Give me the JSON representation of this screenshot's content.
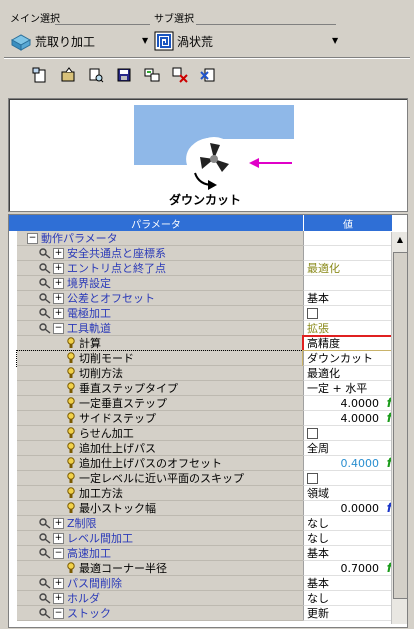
{
  "header": {
    "main_label": "メイン選択",
    "sub_label": "サブ選択",
    "main_value": "荒取り加工",
    "sub_value": "渦状荒"
  },
  "toolbar": {
    "icons": [
      "new-icon",
      "open-icon",
      "find-icon",
      "save-icon",
      "copy-icon",
      "settings-icon",
      "calculate-icon"
    ]
  },
  "preview": {
    "caption": "ダウンカット",
    "arrow_color": "#e000c8",
    "material_color": "#8fb8e8"
  },
  "grid": {
    "col_param": "パラメータ",
    "col_value": "値",
    "rows": [
      {
        "name": "動作パラメータ",
        "value": "",
        "color": "blue",
        "indent": 0,
        "expander": "minus",
        "icon": "none"
      },
      {
        "name": "安全共通点と座標系",
        "value": "",
        "color": "blue",
        "indent": 1,
        "expander": "plus",
        "icon": "key"
      },
      {
        "name": "エントリ点と終了点",
        "value": "最適化",
        "value_color": "olive",
        "color": "blue",
        "indent": 1,
        "expander": "plus",
        "icon": "key"
      },
      {
        "name": "境界設定",
        "value": "",
        "color": "blue",
        "indent": 1,
        "expander": "plus",
        "icon": "key"
      },
      {
        "name": "公差とオフセット",
        "value": "基本",
        "color": "blue",
        "indent": 1,
        "expander": "plus",
        "icon": "key"
      },
      {
        "name": "電極加工",
        "value": "",
        "checkbox": true,
        "color": "blue",
        "indent": 1,
        "expander": "plus",
        "icon": "key"
      },
      {
        "name": "工具軌道",
        "value": "拡張",
        "value_color": "olive",
        "color": "blue",
        "indent": 1,
        "expander": "minus",
        "icon": "key"
      },
      {
        "name": "計算",
        "value": "高精度",
        "color": "black",
        "indent": 2,
        "expander": "none",
        "icon": "bulb"
      },
      {
        "name": "切削モード",
        "value": "ダウンカット",
        "color": "black",
        "indent": 2,
        "expander": "none",
        "icon": "bulb",
        "selected": true
      },
      {
        "name": "切削方法",
        "value": "最適化",
        "color": "black",
        "indent": 2,
        "expander": "none",
        "icon": "bulb"
      },
      {
        "name": "垂直ステップタイプ",
        "value": "一定 + 水平",
        "color": "black",
        "indent": 2,
        "expander": "none",
        "icon": "bulb"
      },
      {
        "name": "一定垂直ステップ",
        "num": "4.0000",
        "f": "green",
        "color": "black",
        "indent": 2,
        "expander": "none",
        "icon": "bulb"
      },
      {
        "name": "サイドステップ",
        "num": "4.0000",
        "f": "green",
        "color": "black",
        "indent": 2,
        "expander": "none",
        "icon": "bulb"
      },
      {
        "name": "らせん加工",
        "value": "",
        "checkbox": true,
        "color": "black",
        "indent": 2,
        "expander": "none",
        "icon": "bulb"
      },
      {
        "name": "追加仕上げパス",
        "value": "全周",
        "color": "black",
        "indent": 2,
        "expander": "none",
        "icon": "bulb"
      },
      {
        "name": "追加仕上げパスのオフセット",
        "num": "0.4000",
        "num_color": "#2a8fd0",
        "f": "green",
        "color": "black",
        "indent": 2,
        "expander": "none",
        "icon": "bulb"
      },
      {
        "name": "一定レベルに近い平面のスキップ",
        "value": "",
        "checkbox": true,
        "color": "black",
        "indent": 2,
        "expander": "none",
        "icon": "bulb"
      },
      {
        "name": "加工方法",
        "value": "領域",
        "color": "black",
        "indent": 2,
        "expander": "none",
        "icon": "bulb"
      },
      {
        "name": "最小ストック幅",
        "num": "0.0000",
        "f": "blue",
        "color": "black",
        "indent": 2,
        "expander": "none",
        "icon": "bulb"
      },
      {
        "name": "Z制限",
        "value": "なし",
        "color": "blue",
        "indent": 1,
        "expander": "plus",
        "icon": "key"
      },
      {
        "name": "レベル間加工",
        "value": "なし",
        "color": "blue",
        "indent": 1,
        "expander": "plus",
        "icon": "key"
      },
      {
        "name": "高速加工",
        "value": "基本",
        "color": "blue",
        "indent": 1,
        "expander": "minus",
        "icon": "key"
      },
      {
        "name": "最適コーナー半径",
        "num": "0.7000",
        "f": "green",
        "color": "black",
        "indent": 2,
        "expander": "none",
        "icon": "bulb"
      },
      {
        "name": "パス間削除",
        "value": "基本",
        "color": "blue",
        "indent": 1,
        "expander": "plus",
        "icon": "key"
      },
      {
        "name": "ホルダ",
        "value": "なし",
        "color": "blue",
        "indent": 1,
        "expander": "plus",
        "icon": "key"
      },
      {
        "name": "ストック",
        "value": "更新",
        "color": "blue",
        "indent": 1,
        "expander": "minus",
        "icon": "key"
      }
    ]
  }
}
